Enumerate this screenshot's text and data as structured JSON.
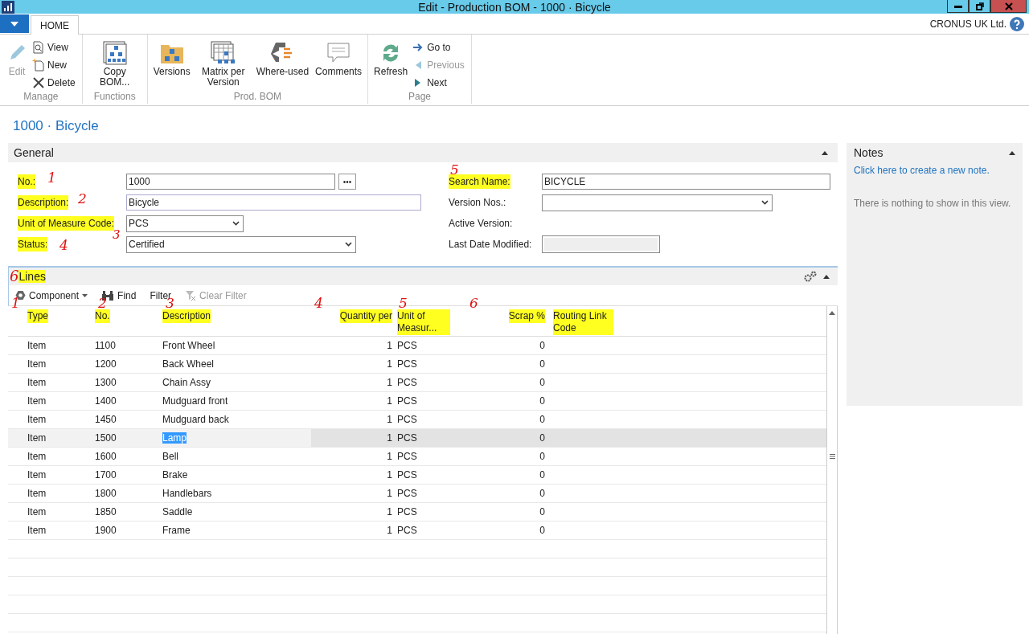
{
  "window": {
    "title": "Edit - Production BOM - 1000 · Bicycle"
  },
  "ribbon": {
    "tabs": [
      {
        "label": "HOME",
        "selected": true
      }
    ],
    "company": "CRONUS UK Ltd.",
    "groups": [
      {
        "label": "Manage",
        "large": [
          {
            "label": "Edit",
            "disabled": true
          }
        ],
        "small": [
          {
            "label": "View",
            "disabled": false
          },
          {
            "label": "New",
            "disabled": false
          },
          {
            "label": "Delete",
            "disabled": false
          }
        ]
      },
      {
        "label": "Functions",
        "large": [
          {
            "label": "Copy BOM...",
            "disabled": false
          }
        ]
      },
      {
        "label": "Prod. BOM",
        "large": [
          {
            "label": "Versions",
            "disabled": false
          },
          {
            "label": "Matrix per Version",
            "disabled": false
          },
          {
            "label": "Where-used",
            "disabled": false
          },
          {
            "label": "Comments",
            "disabled": false
          }
        ]
      },
      {
        "label": "Page",
        "large": [
          {
            "label": "Refresh",
            "disabled": false
          }
        ],
        "small": [
          {
            "label": "Go to",
            "disabled": false
          },
          {
            "label": "Previous",
            "disabled": true
          },
          {
            "label": "Next",
            "disabled": false
          }
        ]
      }
    ]
  },
  "page_title": "1000 · Bicycle",
  "general": {
    "title": "General",
    "left": [
      {
        "label": "No.:",
        "kind": "lookup",
        "value": "1000",
        "highlighted": true,
        "note": "1"
      },
      {
        "label": "Description:",
        "kind": "text",
        "value": "Bicycle",
        "highlighted": true,
        "note": "2"
      },
      {
        "label": "Unit of Measure Code:",
        "kind": "select",
        "value": "PCS",
        "highlighted": true,
        "note": "3"
      },
      {
        "label": "Status:",
        "kind": "select",
        "value": "Certified",
        "highlighted": true,
        "note": "4"
      }
    ],
    "right": [
      {
        "label": "Search Name:",
        "kind": "text",
        "value": "BICYCLE",
        "highlighted": true,
        "note": "5"
      },
      {
        "label": "Version Nos.:",
        "kind": "select",
        "highlighted": false
      },
      {
        "label": "Active Version:",
        "kind": "none",
        "highlighted": false
      },
      {
        "label": "Last Date Modified:",
        "kind": "readonly",
        "highlighted": false
      }
    ]
  },
  "lines": {
    "title": "Lines",
    "highlighted": true,
    "note": "6",
    "toolbar": [
      {
        "label": "Component",
        "kind": "menu",
        "disabled": false
      },
      {
        "label": "Find",
        "kind": "find",
        "disabled": false
      },
      {
        "label": "Filter",
        "kind": "plain",
        "disabled": false
      },
      {
        "label": "Clear Filter",
        "kind": "clear",
        "disabled": true
      }
    ],
    "columns": [
      {
        "label": "Type",
        "highlighted": true,
        "note": "1"
      },
      {
        "label": "No.",
        "highlighted": true,
        "note": "2"
      },
      {
        "label": "Description",
        "highlighted": true,
        "note": "3"
      },
      {
        "label": "Quantity per",
        "highlighted": true,
        "note": "4"
      },
      {
        "label": "Unit of Measur...",
        "highlighted": true,
        "note": "5"
      },
      {
        "label": "Scrap %",
        "highlighted": true,
        "note": "6"
      },
      {
        "label": "Routing Link Code",
        "highlighted": true
      }
    ],
    "rows": [
      {
        "type": "Item",
        "no": "1100",
        "description": "Front Wheel",
        "quantity": "1",
        "unit": "PCS",
        "scrap": "0",
        "selected": false
      },
      {
        "type": "Item",
        "no": "1200",
        "description": "Back Wheel",
        "quantity": "1",
        "unit": "PCS",
        "scrap": "0",
        "selected": false
      },
      {
        "type": "Item",
        "no": "1300",
        "description": "Chain Assy",
        "quantity": "1",
        "unit": "PCS",
        "scrap": "0",
        "selected": false
      },
      {
        "type": "Item",
        "no": "1400",
        "description": "Mudguard front",
        "quantity": "1",
        "unit": "PCS",
        "scrap": "0",
        "selected": false
      },
      {
        "type": "Item",
        "no": "1450",
        "description": "Mudguard back",
        "quantity": "1",
        "unit": "PCS",
        "scrap": "0",
        "selected": false
      },
      {
        "type": "Item",
        "no": "1500",
        "description": "Lamp",
        "quantity": "1",
        "unit": "PCS",
        "scrap": "0",
        "selected": true
      },
      {
        "type": "Item",
        "no": "1600",
        "description": "Bell",
        "quantity": "1",
        "unit": "PCS",
        "scrap": "0",
        "selected": false
      },
      {
        "type": "Item",
        "no": "1700",
        "description": "Brake",
        "quantity": "1",
        "unit": "PCS",
        "scrap": "0",
        "selected": false
      },
      {
        "type": "Item",
        "no": "1800",
        "description": "Handlebars",
        "quantity": "1",
        "unit": "PCS",
        "scrap": "0",
        "selected": false
      },
      {
        "type": "Item",
        "no": "1850",
        "description": "Saddle",
        "quantity": "1",
        "unit": "PCS",
        "scrap": "0",
        "selected": false
      },
      {
        "type": "Item",
        "no": "1900",
        "description": "Frame",
        "quantity": "1",
        "unit": "PCS",
        "scrap": "0",
        "selected": false
      }
    ]
  },
  "notes": {
    "title": "Notes",
    "link": "Click here to create a new note.",
    "empty": "There is nothing to show in this view."
  }
}
